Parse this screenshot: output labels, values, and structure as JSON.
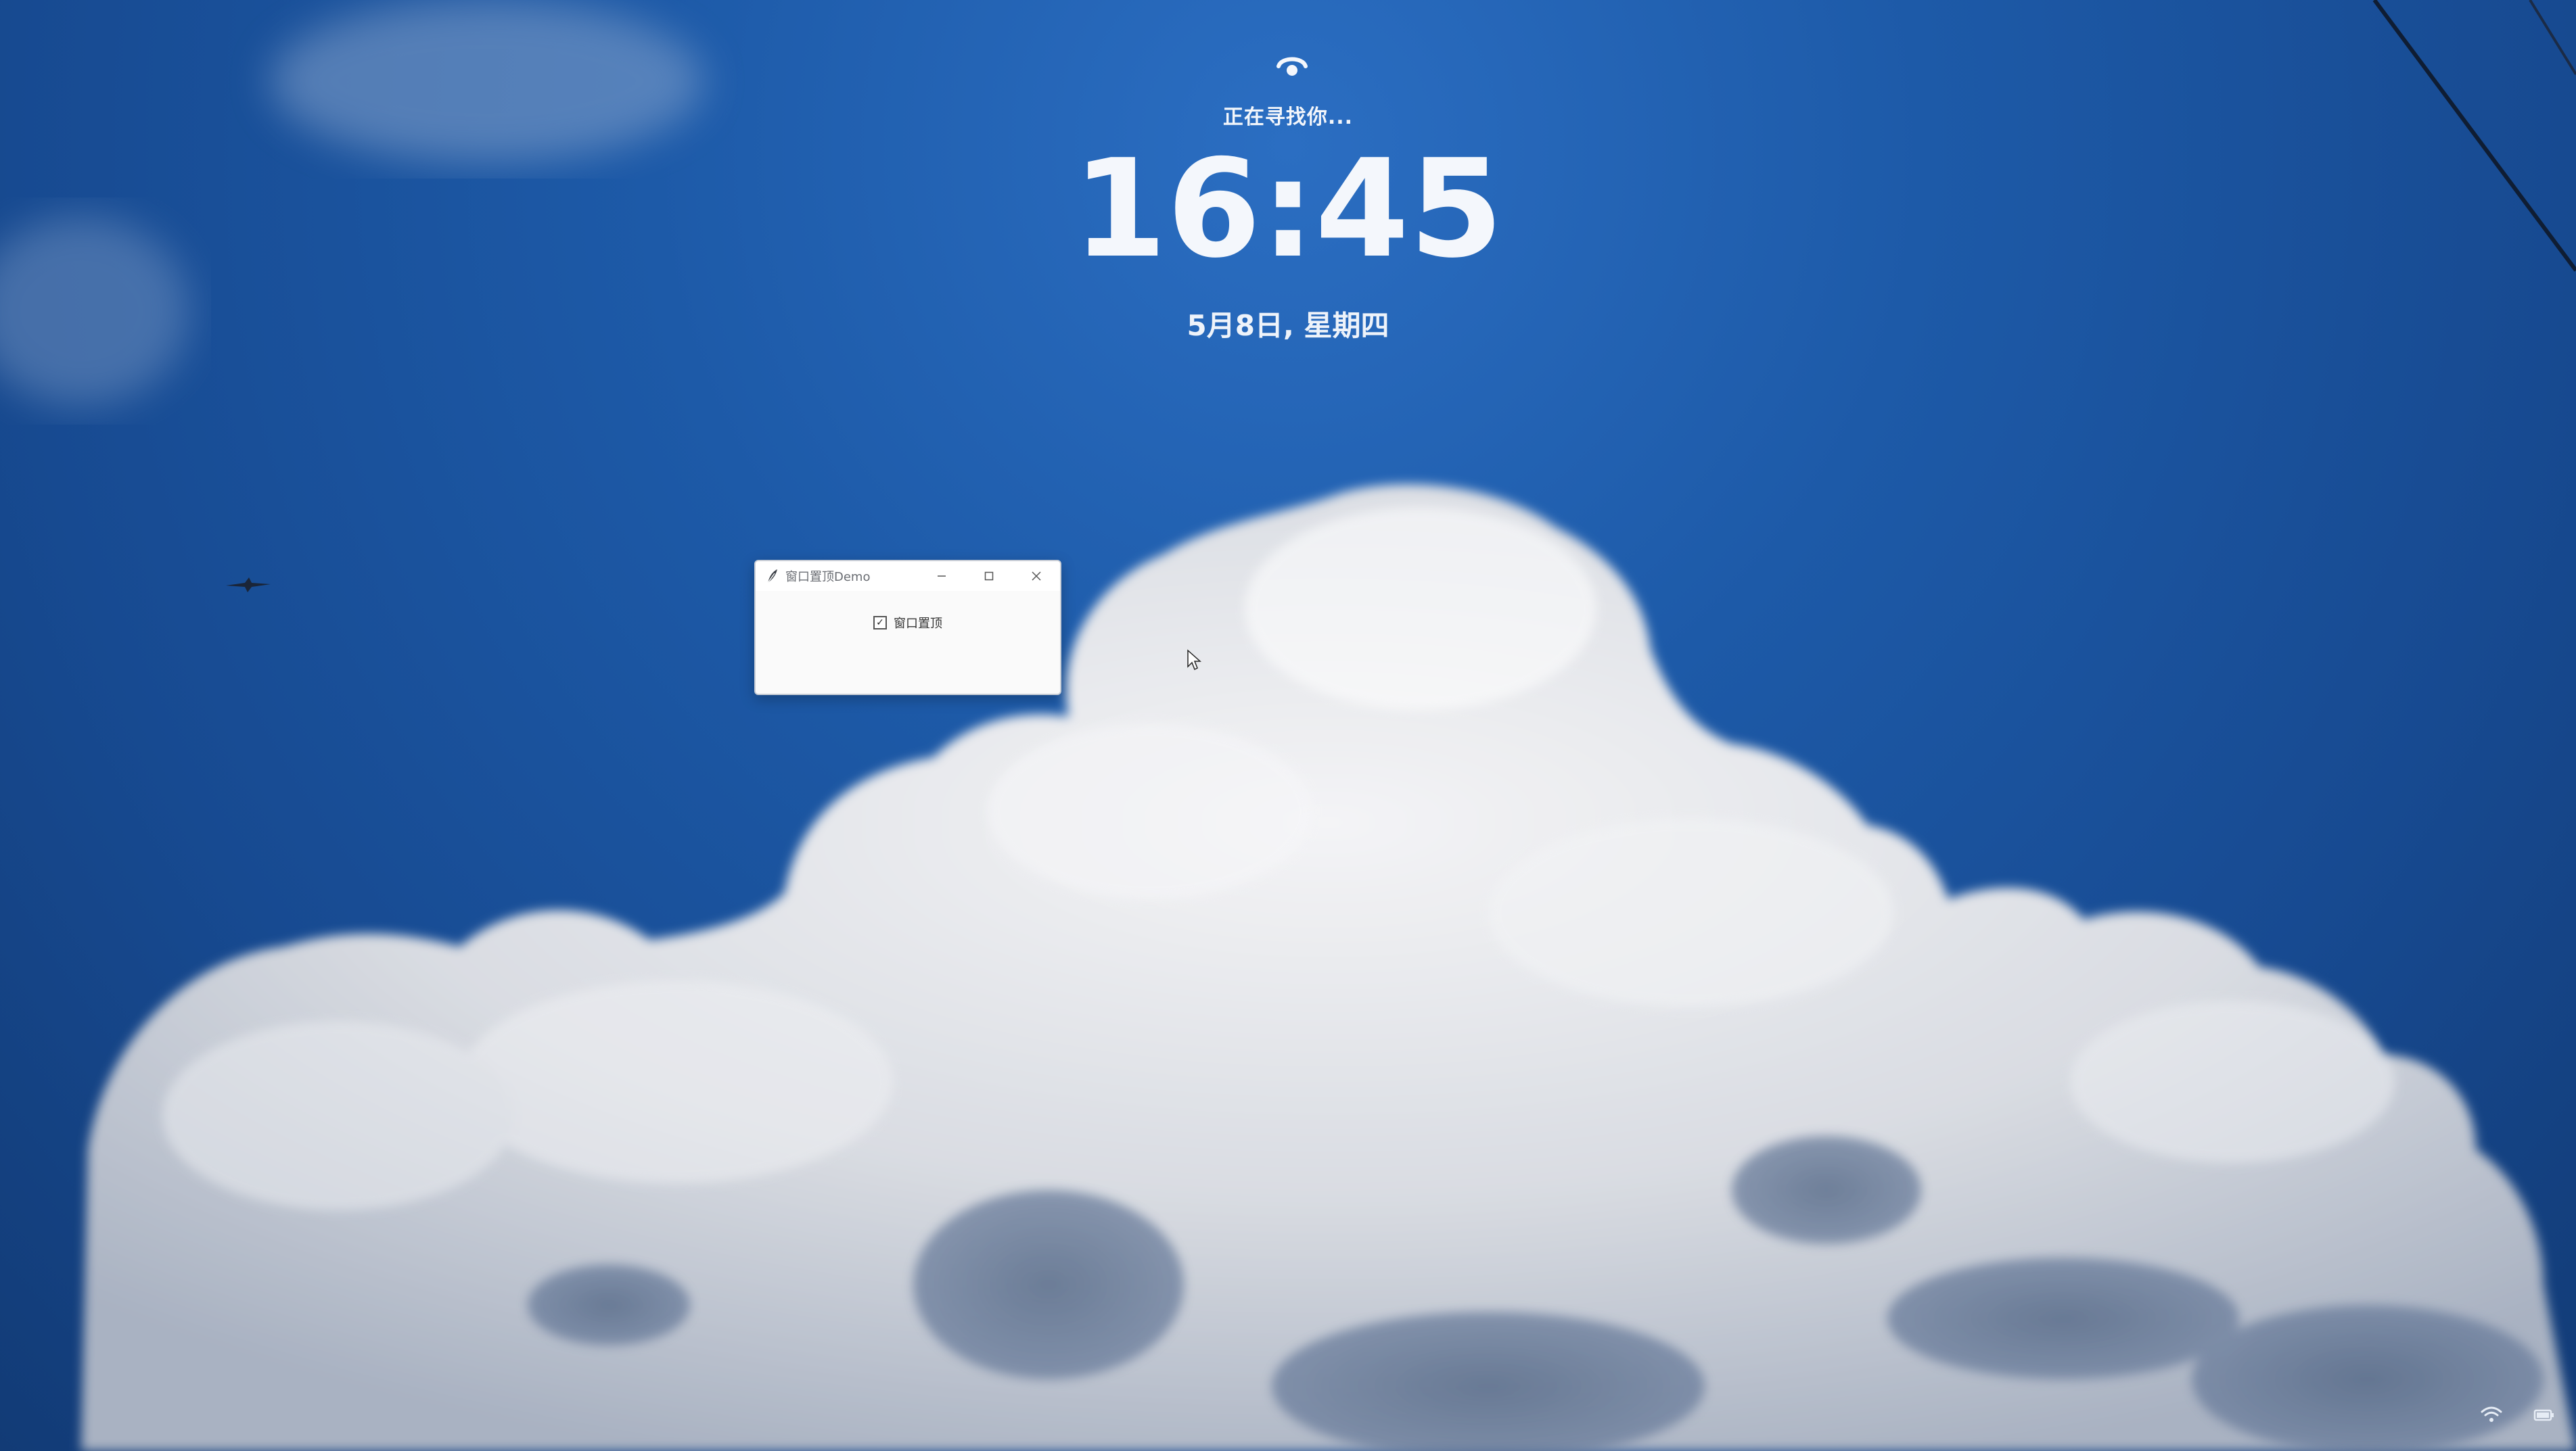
{
  "lock_screen": {
    "status_text": "正在寻找你...",
    "time": "16:45",
    "date": "5月8日, 星期四",
    "face_unlock_icon": "face-recognition-icon"
  },
  "window": {
    "title": "窗口置顶Demo",
    "app_icon": "feather-icon",
    "controls": {
      "minimize": "minimize-icon",
      "maximize": "maximize-icon",
      "close": "close-icon"
    },
    "checkbox": {
      "label": "窗口置顶",
      "checked": true
    }
  },
  "system_icons": {
    "network": "wifi-icon",
    "battery": "battery-icon"
  },
  "colors": {
    "sky": "#1d5aa8",
    "cloud": "#e6e8ec",
    "text": "#f4f7fc"
  }
}
